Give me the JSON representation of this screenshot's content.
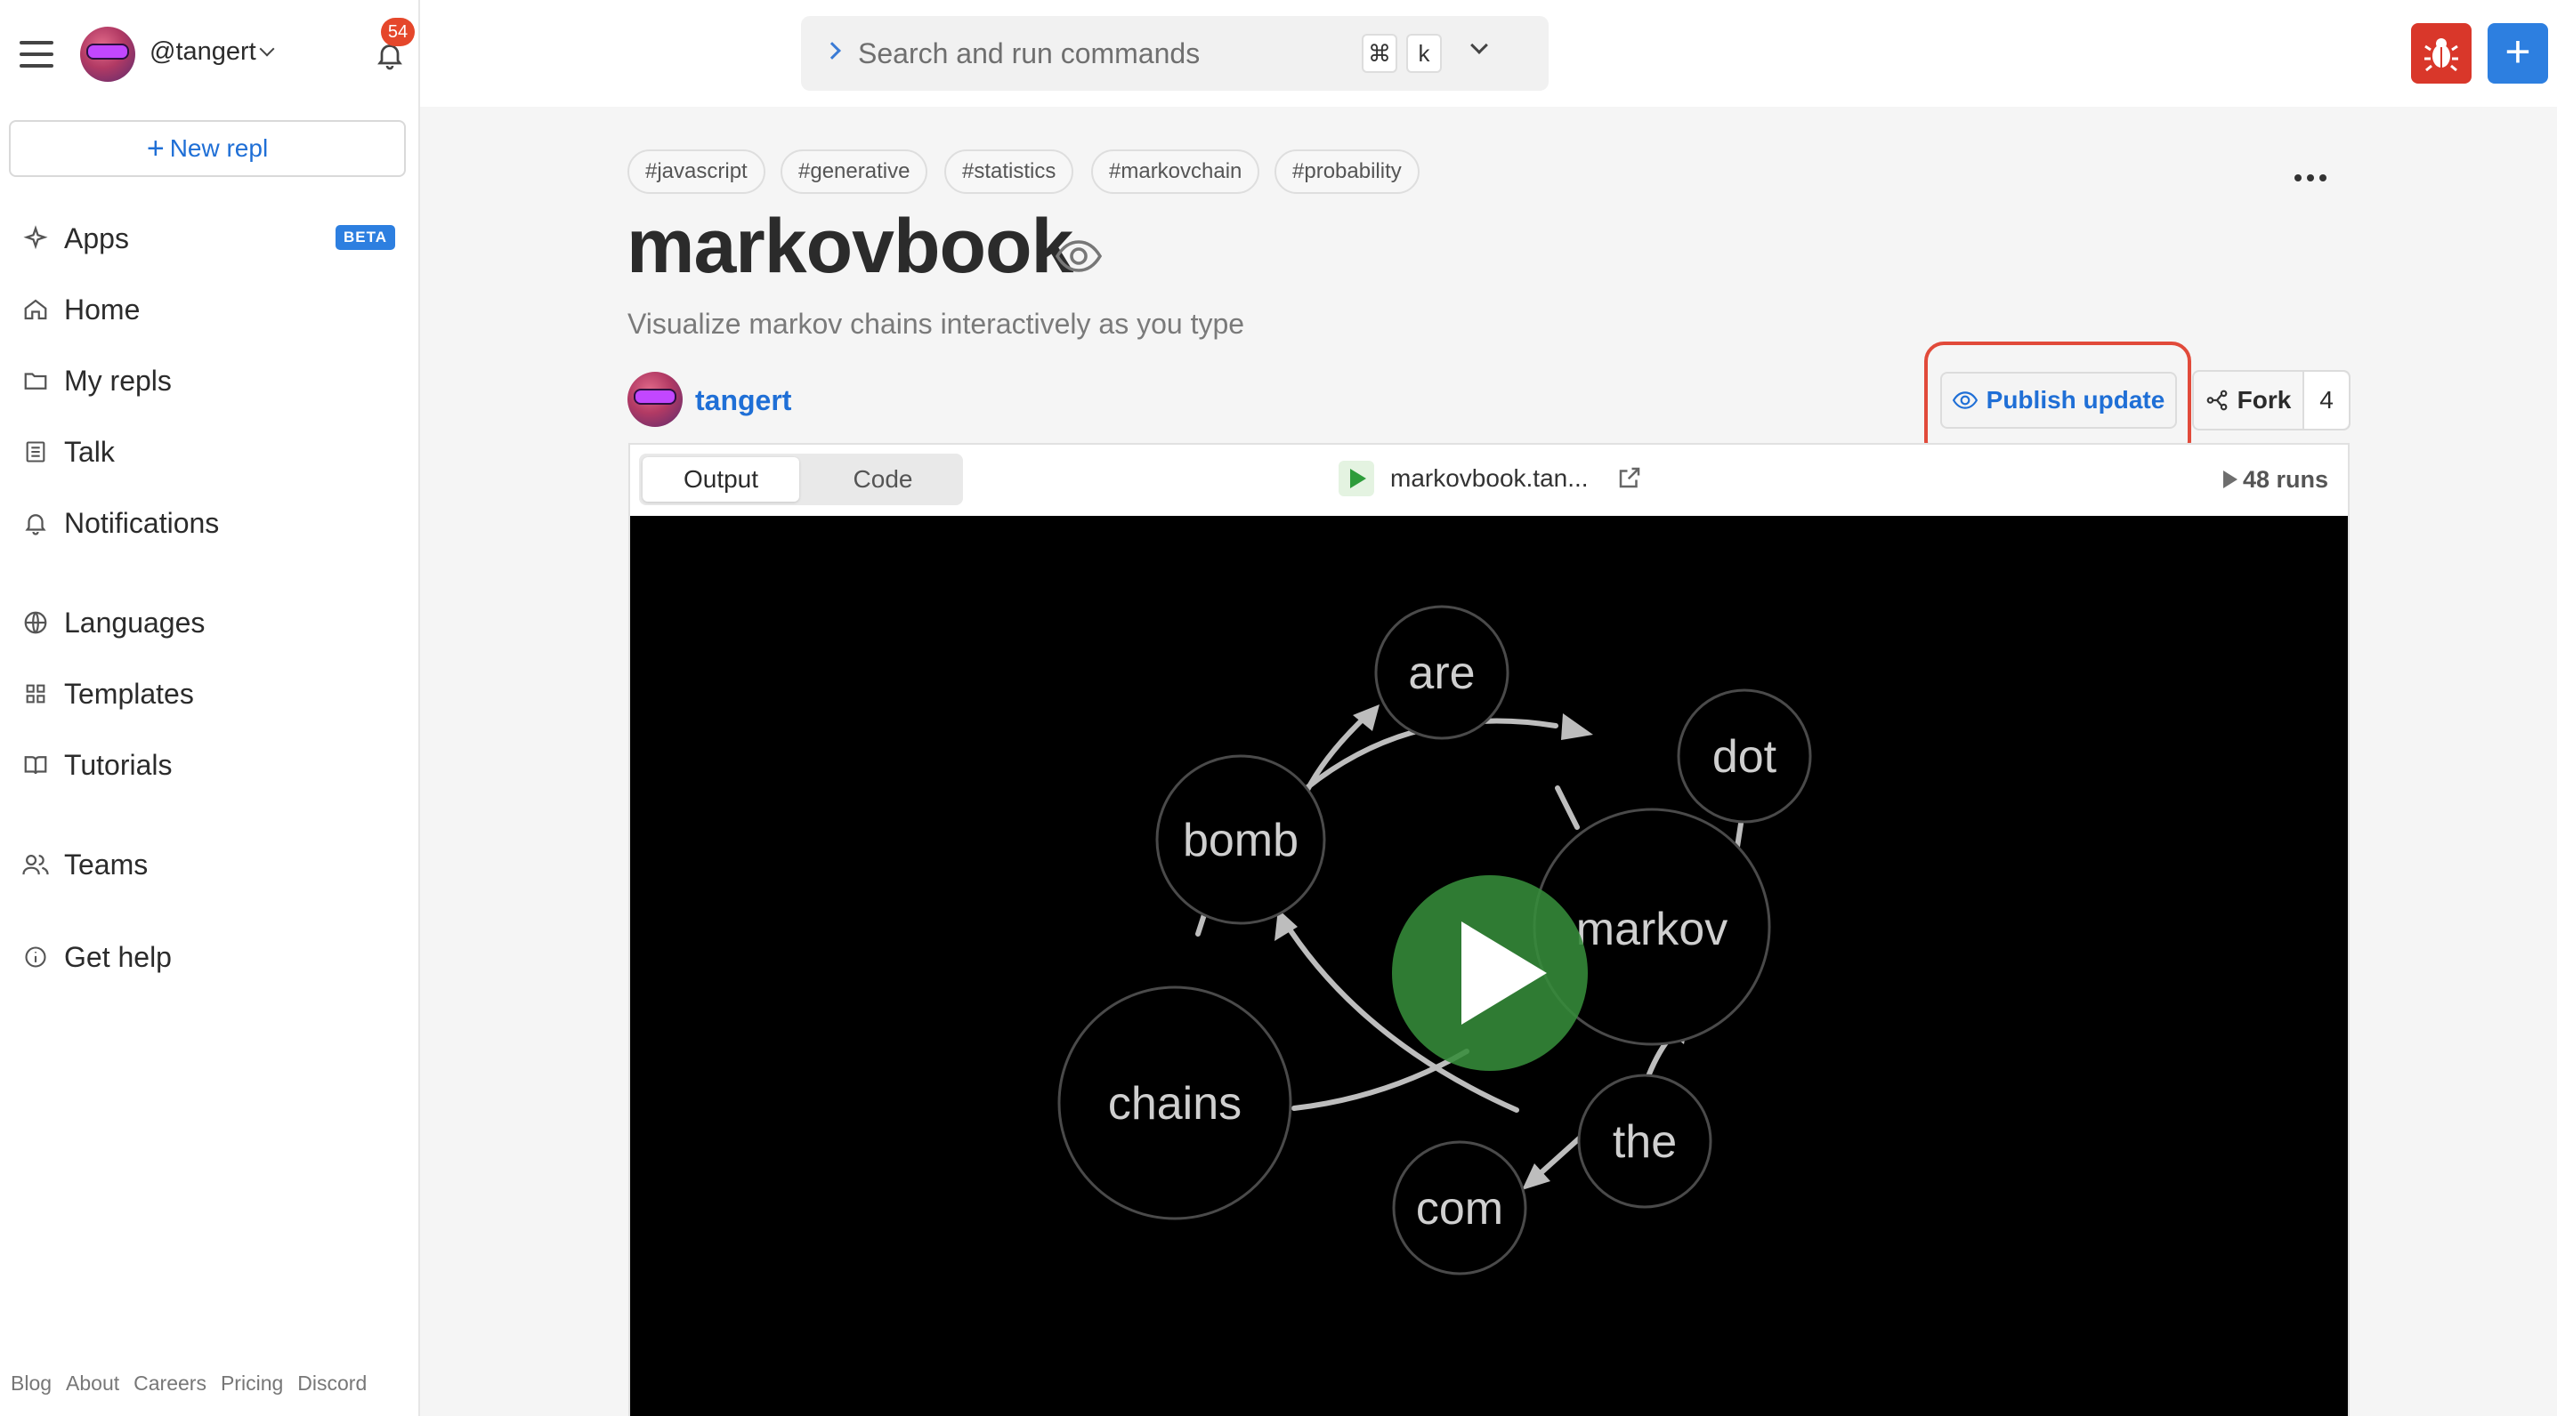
{
  "sidebar": {
    "username": "@tangert",
    "notification_count": "54",
    "new_repl_label": "New repl",
    "beta_badge": "BETA",
    "items": [
      {
        "label": "Apps",
        "icon": "sparkle-icon"
      },
      {
        "label": "Home",
        "icon": "home-icon"
      },
      {
        "label": "My repls",
        "icon": "folder-icon"
      },
      {
        "label": "Talk",
        "icon": "talk-icon"
      },
      {
        "label": "Notifications",
        "icon": "bell-icon"
      },
      {
        "label": "Languages",
        "icon": "globe-icon"
      },
      {
        "label": "Templates",
        "icon": "templates-icon"
      },
      {
        "label": "Tutorials",
        "icon": "book-icon"
      },
      {
        "label": "Teams",
        "icon": "people-icon"
      },
      {
        "label": "Get help",
        "icon": "info-icon"
      }
    ],
    "footer": [
      "Blog",
      "About",
      "Careers",
      "Pricing",
      "Discord"
    ]
  },
  "search": {
    "placeholder": "Search and run commands",
    "shortcut_key1": "⌘",
    "shortcut_key2": "k"
  },
  "repl": {
    "tags": [
      "#javascript",
      "#generative",
      "#statistics",
      "#markovchain",
      "#probability"
    ],
    "title": "markovbook",
    "description": "Visualize markov chains interactively as you type",
    "author": "tangert",
    "publish_label": "Publish update",
    "fork_label": "Fork",
    "fork_count": "4"
  },
  "panel": {
    "tab_output": "Output",
    "tab_code": "Code",
    "url": "markovbook.tan...",
    "runs": "48 runs"
  },
  "graph": {
    "nodes": [
      "are",
      "dot",
      "bomb",
      "markov",
      "chains",
      "the",
      "com"
    ]
  },
  "colors": {
    "accent": "#1f6fd6",
    "danger": "#d9372a",
    "highlight": "#e14a3a",
    "play": "#368c3a"
  }
}
